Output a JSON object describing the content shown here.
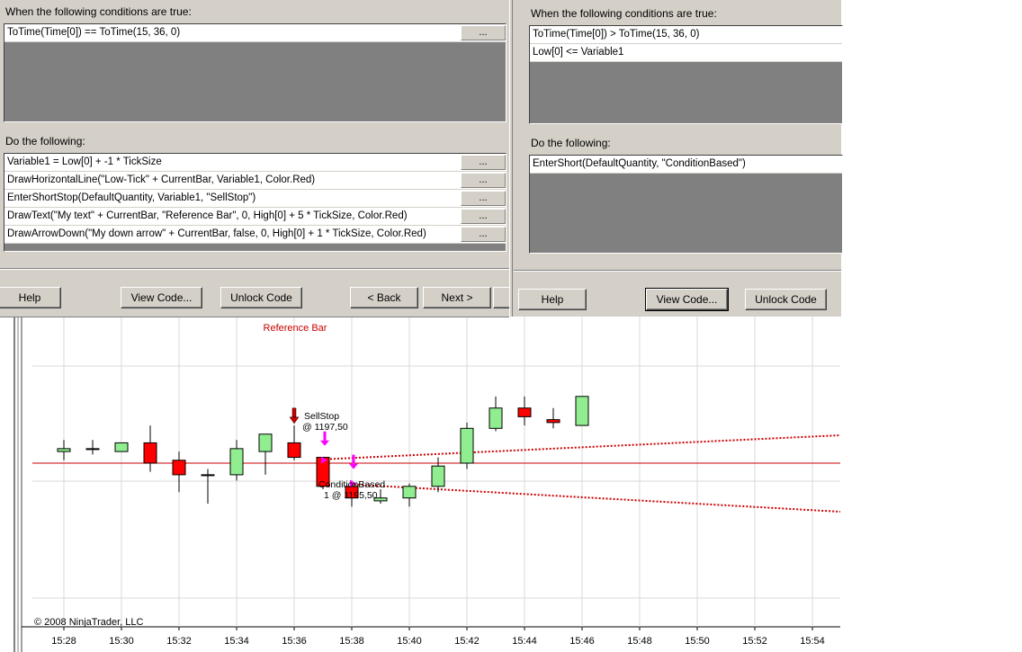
{
  "left_dialog": {
    "conditions_label": "When the following conditions are true:",
    "conditions": [
      "ToTime(Time[0]) == ToTime(15, 36, 0)"
    ],
    "actions_label": "Do the following:",
    "actions": [
      "Variable1 = Low[0] + -1 * TickSize",
      "DrawHorizontalLine(\"Low-Tick\" + CurrentBar, Variable1, Color.Red)",
      "EnterShortStop(DefaultQuantity, Variable1, \"SellStop\")",
      "DrawText(\"My text\" + CurrentBar, \"Reference Bar\", 0, High[0] + 5 * TickSize, Color.Red)",
      "DrawArrowDown(\"My down arrow\" + CurrentBar, false, 0, High[0] + 1 * TickSize, Color.Red)"
    ],
    "ellipsis_label": "...",
    "buttons": {
      "help": "Help",
      "view_code": "View Code...",
      "unlock_code": "Unlock Code",
      "back": "< Back",
      "next": "Next >"
    }
  },
  "right_dialog": {
    "conditions_label": "When the following conditions are true:",
    "conditions": [
      "ToTime(Time[0]) > ToTime(15, 36, 0)",
      "Low[0] <= Variable1"
    ],
    "actions_label": "Do the following:",
    "actions": [
      "EnterShort(DefaultQuantity, \"ConditionBased\")"
    ],
    "buttons": {
      "help": "Help",
      "view_code": "View Code...",
      "unlock_code": "Unlock Code"
    }
  },
  "chart": {
    "copyright": "© 2008 NinjaTrader, LLC",
    "reference_label": "Reference Bar",
    "sellstop_label": "SellStop",
    "sellstop_price": "@ 1197,50",
    "condition_label": "ConditionBased",
    "condition_price": "1 @ 1195,50",
    "colors": {
      "up": "#90ee90",
      "down": "#ff0000",
      "reference": "#cc0000",
      "fill_marker": "#ff00ff",
      "grid": "#d8d8d8"
    }
  },
  "chart_data": {
    "type": "candlestick",
    "x_labels": [
      "15:28",
      "15:30",
      "15:32",
      "15:34",
      "15:36",
      "15:38",
      "15:40",
      "15:42",
      "15:44",
      "15:46",
      "15:48",
      "15:50",
      "15:52",
      "15:54"
    ],
    "bars": [
      {
        "time": "15:28",
        "open": 1198.25,
        "high": 1199.25,
        "low": 1197.5,
        "close": 1198.5
      },
      {
        "time": "15:29",
        "open": 1198.5,
        "high": 1199.25,
        "low": 1198.0,
        "close": 1198.5
      },
      {
        "time": "15:30",
        "open": 1198.25,
        "high": 1199.0,
        "low": 1198.25,
        "close": 1199.0
      },
      {
        "time": "15:31",
        "open": 1199.0,
        "high": 1200.5,
        "low": 1196.5,
        "close": 1197.25
      },
      {
        "time": "15:32",
        "open": 1197.5,
        "high": 1198.25,
        "low": 1194.75,
        "close": 1196.25
      },
      {
        "time": "15:33",
        "open": 1196.25,
        "high": 1196.75,
        "low": 1193.75,
        "close": 1196.25
      },
      {
        "time": "15:34",
        "open": 1196.25,
        "high": 1199.25,
        "low": 1195.75,
        "close": 1198.5
      },
      {
        "time": "15:35",
        "open": 1198.25,
        "high": 1199.75,
        "low": 1196.25,
        "close": 1199.75
      },
      {
        "time": "15:36",
        "open": 1199.0,
        "high": 1200.5,
        "low": 1197.5,
        "close": 1197.75
      },
      {
        "time": "15:37",
        "open": 1197.75,
        "high": 1197.75,
        "low": 1195.0,
        "close": 1195.25
      },
      {
        "time": "15:38",
        "open": 1195.25,
        "high": 1195.75,
        "low": 1193.5,
        "close": 1194.25
      },
      {
        "time": "15:39",
        "open": 1194.0,
        "high": 1195.0,
        "low": 1193.75,
        "close": 1194.25
      },
      {
        "time": "15:40",
        "open": 1194.25,
        "high": 1195.5,
        "low": 1193.5,
        "close": 1195.25
      },
      {
        "time": "15:41",
        "open": 1195.25,
        "high": 1197.75,
        "low": 1194.75,
        "close": 1197.0
      },
      {
        "time": "15:42",
        "open": 1197.25,
        "high": 1200.75,
        "low": 1196.75,
        "close": 1200.25
      },
      {
        "time": "15:43",
        "open": 1200.25,
        "high": 1203.0,
        "low": 1200.0,
        "close": 1202.0
      },
      {
        "time": "15:44",
        "open": 1202.0,
        "high": 1203.0,
        "low": 1200.5,
        "close": 1201.25
      },
      {
        "time": "15:45",
        "open": 1201.0,
        "high": 1202.0,
        "low": 1200.25,
        "close": 1200.75
      },
      {
        "time": "15:46",
        "open": 1200.5,
        "high": 1203.0,
        "low": 1200.5,
        "close": 1203.0
      }
    ],
    "horizontal_lines": [
      {
        "name": "Low-Tick",
        "price": 1197.25
      }
    ],
    "arrows": [
      {
        "time": "15:36",
        "direction": "down",
        "price": 1200.75
      }
    ],
    "fills": [
      {
        "name": "SellStop",
        "time": "15:37",
        "price": 1197.5
      },
      {
        "name": "ConditionBased",
        "time": "15:38",
        "price": 1195.5
      }
    ]
  }
}
